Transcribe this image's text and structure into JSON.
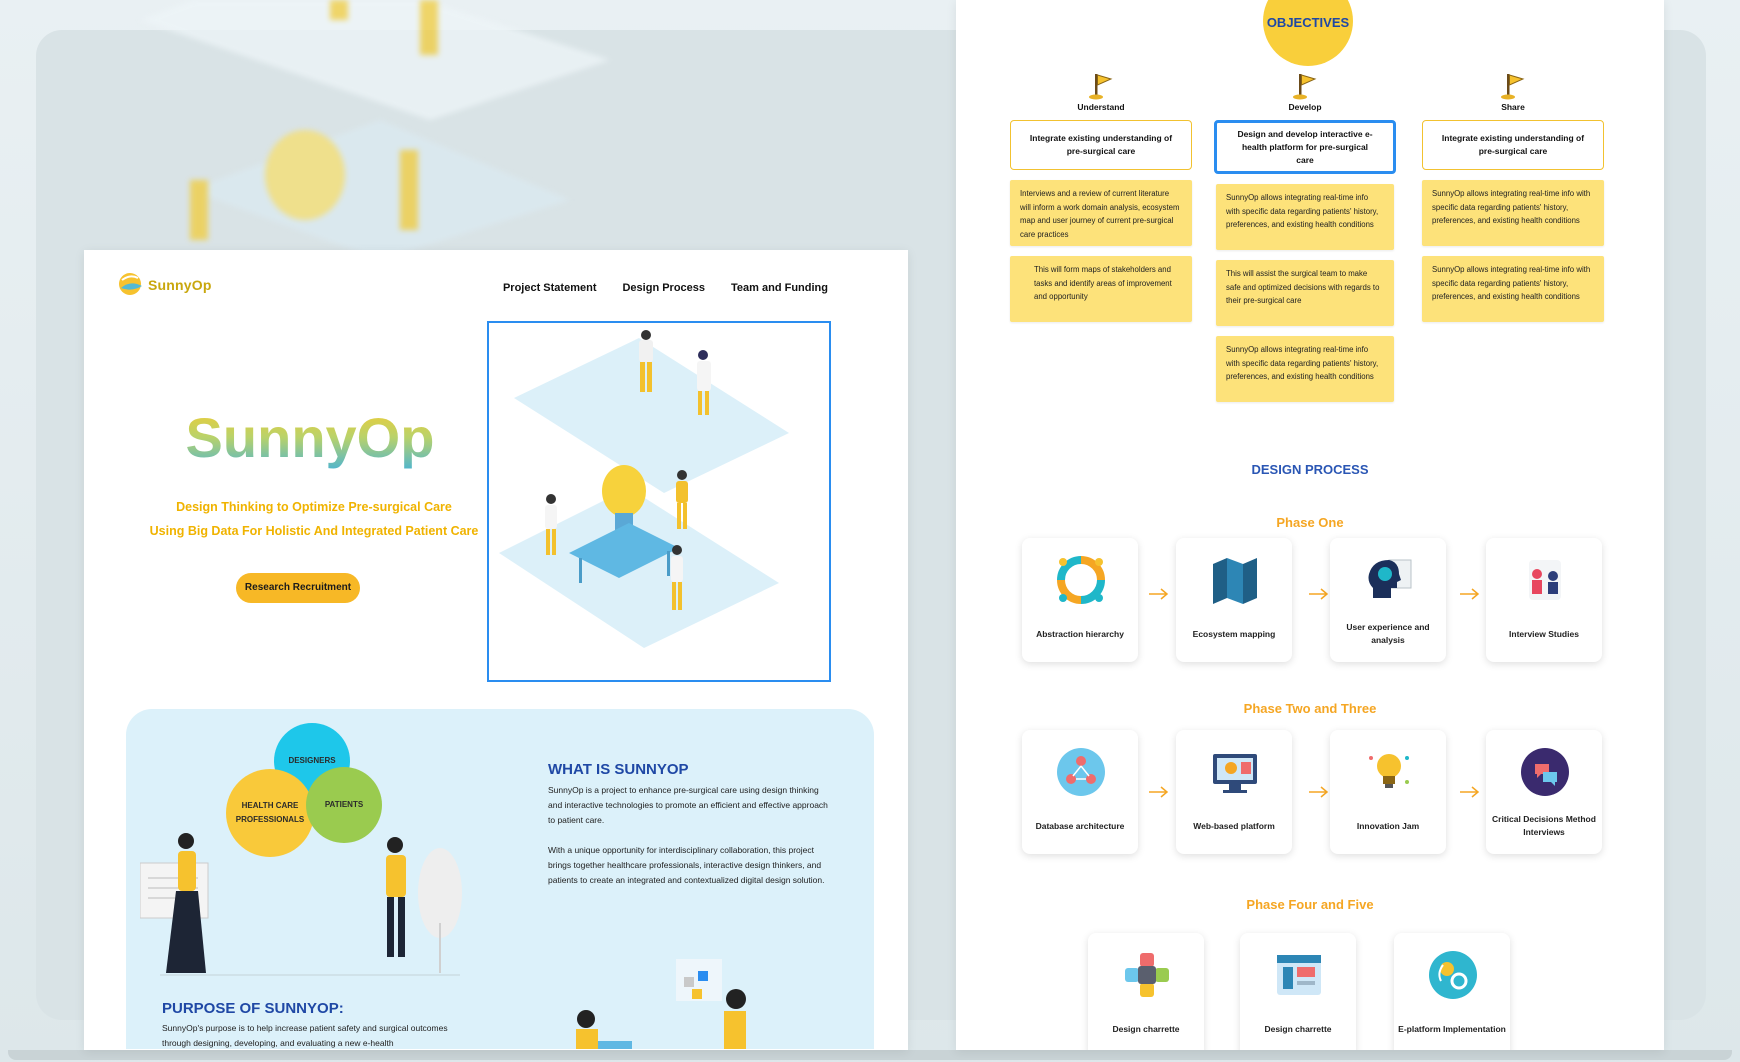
{
  "brand": {
    "name": "SunnyOp"
  },
  "nav": {
    "items": [
      "Project Statement",
      "Design Process",
      "Team and Funding"
    ]
  },
  "hero": {
    "title": "SunnyOp",
    "subtitle_line1": "Design Thinking to Optimize Pre-surgical Care",
    "subtitle_line2": "Using Big Data For Holistic And Integrated Patient Care",
    "cta_label": "Research Recruitment"
  },
  "venn": {
    "designers": "DESIGNERS",
    "health_line1": "HEALTH CARE",
    "health_line2": "PROFESSIONALS",
    "patients": "PATIENTS"
  },
  "what": {
    "title": "WHAT IS SUNNYOP",
    "para1": "SunnyOp is a project to enhance pre-surgical care using design thinking and interactive technologies to promote an efficient and effective approach to patient care.",
    "para2": "With a unique opportunity for interdisciplinary collaboration, this project brings together healthcare professionals, interactive design thinkers, and patients to create an integrated and contextualized digital design solution."
  },
  "purpose": {
    "title": "PURPOSE OF SUNNYOP:",
    "body": "SunnyOp's purpose is to help increase patient safety and surgical outcomes through designing, developing, and evaluating a new e-health"
  },
  "objectives": {
    "title": "OBJECTIVES",
    "columns": [
      {
        "label": "Understand",
        "heading": "Integrate existing understanding of pre-surgical care",
        "notes": [
          "Interviews and a review of current literature will inform a work domain analysis, ecosystem map and user journey of current pre-surgical care practices",
          "This will form maps of stakeholders and tasks and identify areas of improvement and opportunity"
        ]
      },
      {
        "label": "Develop",
        "heading": "Design and develop interactive e-health platform for pre-surgical care",
        "notes": [
          "SunnyOp allows integrating real-time info with specific data regarding patients' history, preferences, and existing health conditions",
          "This will assist the surgical team to make safe and optimized decisions with regards to their pre-surgical care",
          "SunnyOp allows integrating real-time info with specific data regarding patients' history, preferences, and existing health conditions"
        ]
      },
      {
        "label": "Share",
        "heading": "Integrate existing understanding of pre-surgical care",
        "notes": [
          "SunnyOp allows integrating real-time info with specific data regarding patients' history, preferences, and existing health conditions",
          "SunnyOp allows integrating real-time info with specific data regarding patients' history, preferences, and existing health conditions"
        ]
      }
    ]
  },
  "design_process": {
    "title": "DESIGN PROCESS",
    "phase1": {
      "title": "Phase One",
      "steps": [
        "Abstraction hierarchy",
        "Ecosystem mapping",
        "User experience and analysis",
        "Interview Studies"
      ]
    },
    "phase2": {
      "title": "Phase Two and Three",
      "steps": [
        "Database architecture",
        "Web-based platform",
        "Innovation Jam",
        "Critical Decisions Method Interviews"
      ]
    },
    "phase3": {
      "title": "Phase Four and Five",
      "steps": [
        "Design charrette",
        "Design charrette",
        "E-platform Implementation"
      ]
    }
  },
  "colors": {
    "accent_yellow": "#f7b826",
    "brand_blue": "#1f48a5",
    "selection_blue": "#2a8df0",
    "sticky_yellow": "#fde27a",
    "phase_orange": "#f5a623"
  }
}
